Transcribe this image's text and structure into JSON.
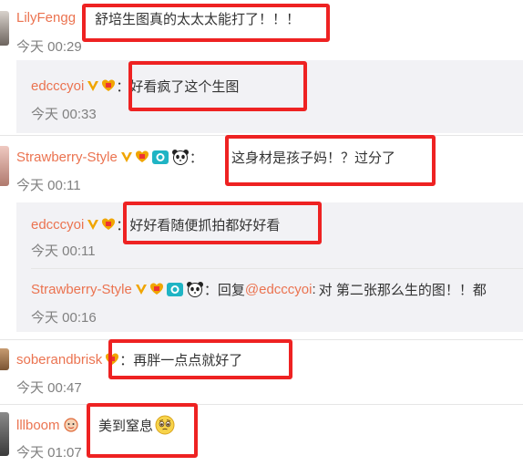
{
  "comments": [
    {
      "user": "LilyFengg",
      "text": "舒培生图真的太太太能打了！！！",
      "time": "今天 00:29",
      "replies": [
        {
          "user": "edcccyoi",
          "text": "好看疯了这个生图",
          "time": "今天 00:33"
        }
      ]
    },
    {
      "user": "Strawberry-Style",
      "text": "这身材是孩子妈！？过分了",
      "time": "今天 00:11",
      "replies": [
        {
          "user": "edcccyoi",
          "text": "好好看随便抓拍都好好看",
          "time": "今天 00:11"
        },
        {
          "user": "Strawberry-Style",
          "reply_prefix": "回复",
          "mention": "@edcccyoi",
          "text": "对 第二张那么生的图！！都",
          "time": "今天 00:16"
        }
      ]
    },
    {
      "user": "soberandbrisk",
      "text": "再胖一点点就好了",
      "time": "今天 00:47"
    },
    {
      "user": "lllboom",
      "text": "美到窒息",
      "time": "今天 01:07"
    }
  ],
  "separator": "：",
  "icons": {
    "verified": "verified-v-icon",
    "member": "vip-member-icon",
    "camera": "camera-badge-icon",
    "panda": "panda-badge-icon",
    "emoji": "pleading-face-emoji",
    "avatar_badge": "avatar-badge-icon"
  },
  "colors": {
    "username": "#eb7350",
    "timestamp": "#808080",
    "reply_background": "#f2f2f5",
    "highlight_box": "#ee2222"
  }
}
